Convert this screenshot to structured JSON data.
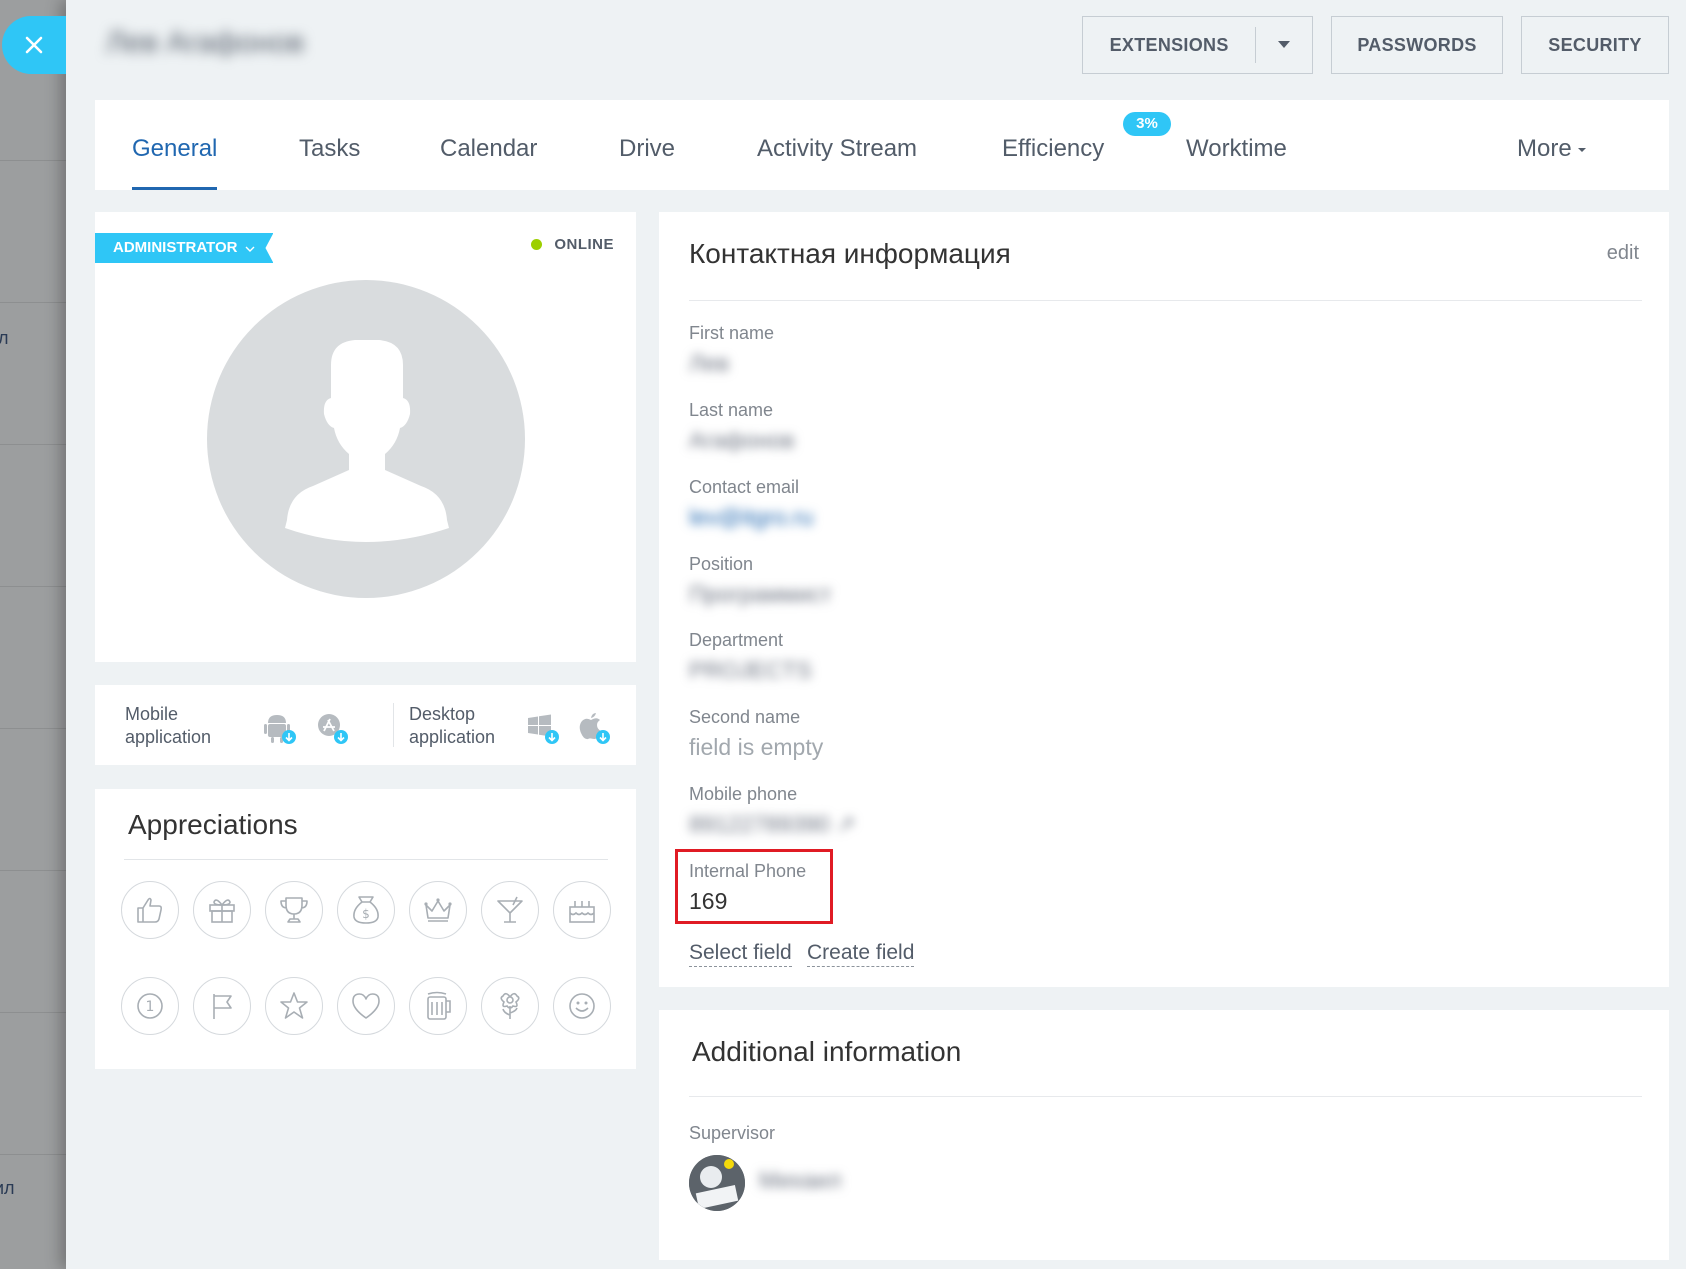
{
  "backdrop": {
    "fragment_1": "л",
    "fragment_2": "ил"
  },
  "header": {
    "user_name": "Лев Агафонов",
    "buttons": {
      "extensions": "EXTENSIONS",
      "passwords": "PASSWORDS",
      "security": "SECURITY"
    }
  },
  "tabs": [
    {
      "label": "General",
      "active": true
    },
    {
      "label": "Tasks"
    },
    {
      "label": "Calendar"
    },
    {
      "label": "Drive"
    },
    {
      "label": "Activity Stream"
    },
    {
      "label": "Efficiency",
      "badge": "3%"
    },
    {
      "label": "Worktime"
    },
    {
      "label": "More"
    }
  ],
  "profile": {
    "role": "ADMINISTRATOR",
    "status": "ONLINE",
    "status_color": "#9dcf00"
  },
  "apps": {
    "mobile": {
      "label_line1": "Mobile",
      "label_line2": "application",
      "icons": [
        "android-icon",
        "app-store-icon"
      ]
    },
    "desktop": {
      "label_line1": "Desktop",
      "label_line2": "application",
      "icons": [
        "windows-icon",
        "apple-icon"
      ]
    }
  },
  "appreciations": {
    "title": "Appreciations",
    "icons": [
      "thumbs-up-icon",
      "gift-icon",
      "trophy-icon",
      "money-bag-icon",
      "crown-icon",
      "cocktail-icon",
      "cake-icon",
      "number-one-icon",
      "flag-icon",
      "star-icon",
      "heart-icon",
      "beer-icon",
      "flower-icon",
      "smile-icon"
    ]
  },
  "contact": {
    "title": "Контактная информация",
    "edit": "edit",
    "fields": [
      {
        "label": "First name",
        "value": "Лев"
      },
      {
        "label": "Last name",
        "value": "Агафонов"
      },
      {
        "label": "Contact email",
        "value": "lev@itgro.ru"
      },
      {
        "label": "Position",
        "value": "Программист"
      },
      {
        "label": "Department",
        "value": "PROJECTS"
      },
      {
        "label": "Second name",
        "value": "field is empty"
      },
      {
        "label": "Mobile phone",
        "value": "89122789390 ↗"
      },
      {
        "label": "Internal Phone",
        "value": "169"
      }
    ],
    "select_field": "Select field",
    "create_field": "Create field"
  },
  "additional": {
    "title": "Additional information",
    "supervisor_label": "Supervisor",
    "supervisor_name": "Михаил"
  },
  "colors": {
    "accent": "#2fc6f6",
    "active_tab": "#2067b0",
    "highlight": "#e01b24"
  }
}
